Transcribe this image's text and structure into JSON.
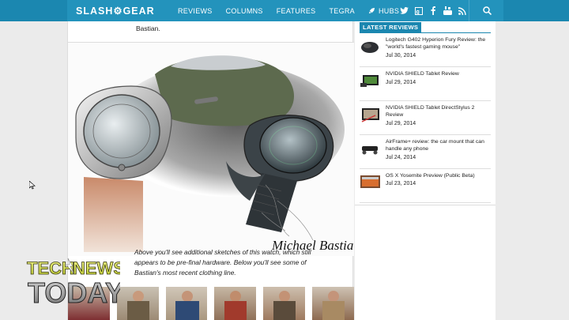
{
  "nav": {
    "logo": "SLASH⚙GEAR",
    "links": [
      "REVIEWS",
      "COLUMNS",
      "FEATURES",
      "TEGRA",
      "HUBS"
    ],
    "social_icons": [
      "twitter-icon",
      "google-plus-icon",
      "facebook-icon",
      "youtube-icon",
      "rss-icon"
    ]
  },
  "article": {
    "top_text": "Bastian.",
    "sketch_signature": "Michael Bastian",
    "caption": "Above you'll see additional sketches of this watch, which still appears to be pre-final hardware. Below you'll see some of Bastian's most recent clothing line."
  },
  "sidebar": {
    "header": "LATEST REVIEWS",
    "reviews": [
      {
        "title": "Logitech G402 Hyperion Fury Review: the \"world's fastest gaming mouse\"",
        "date": "Jul 30, 2014"
      },
      {
        "title": "NVIDIA SHIELD Tablet Review",
        "date": "Jul 29, 2014"
      },
      {
        "title": "NVIDIA SHIELD Tablet DirectStylus 2 Review",
        "date": "Jul 29, 2014"
      },
      {
        "title": "AirFrame+ review: the car mount that can handle any phone",
        "date": "Jul 24, 2014"
      },
      {
        "title": "OS X Yosemite Preview (Public Beta)",
        "date": "Jul 23, 2014"
      }
    ]
  },
  "overlay": {
    "line1": "TECH",
    "line1b": "NEWS",
    "line2": "TODAY"
  },
  "colors": {
    "accent": "#1b87b0",
    "nav": "#2393bc",
    "overlay_yellow": "#d6e33a"
  }
}
